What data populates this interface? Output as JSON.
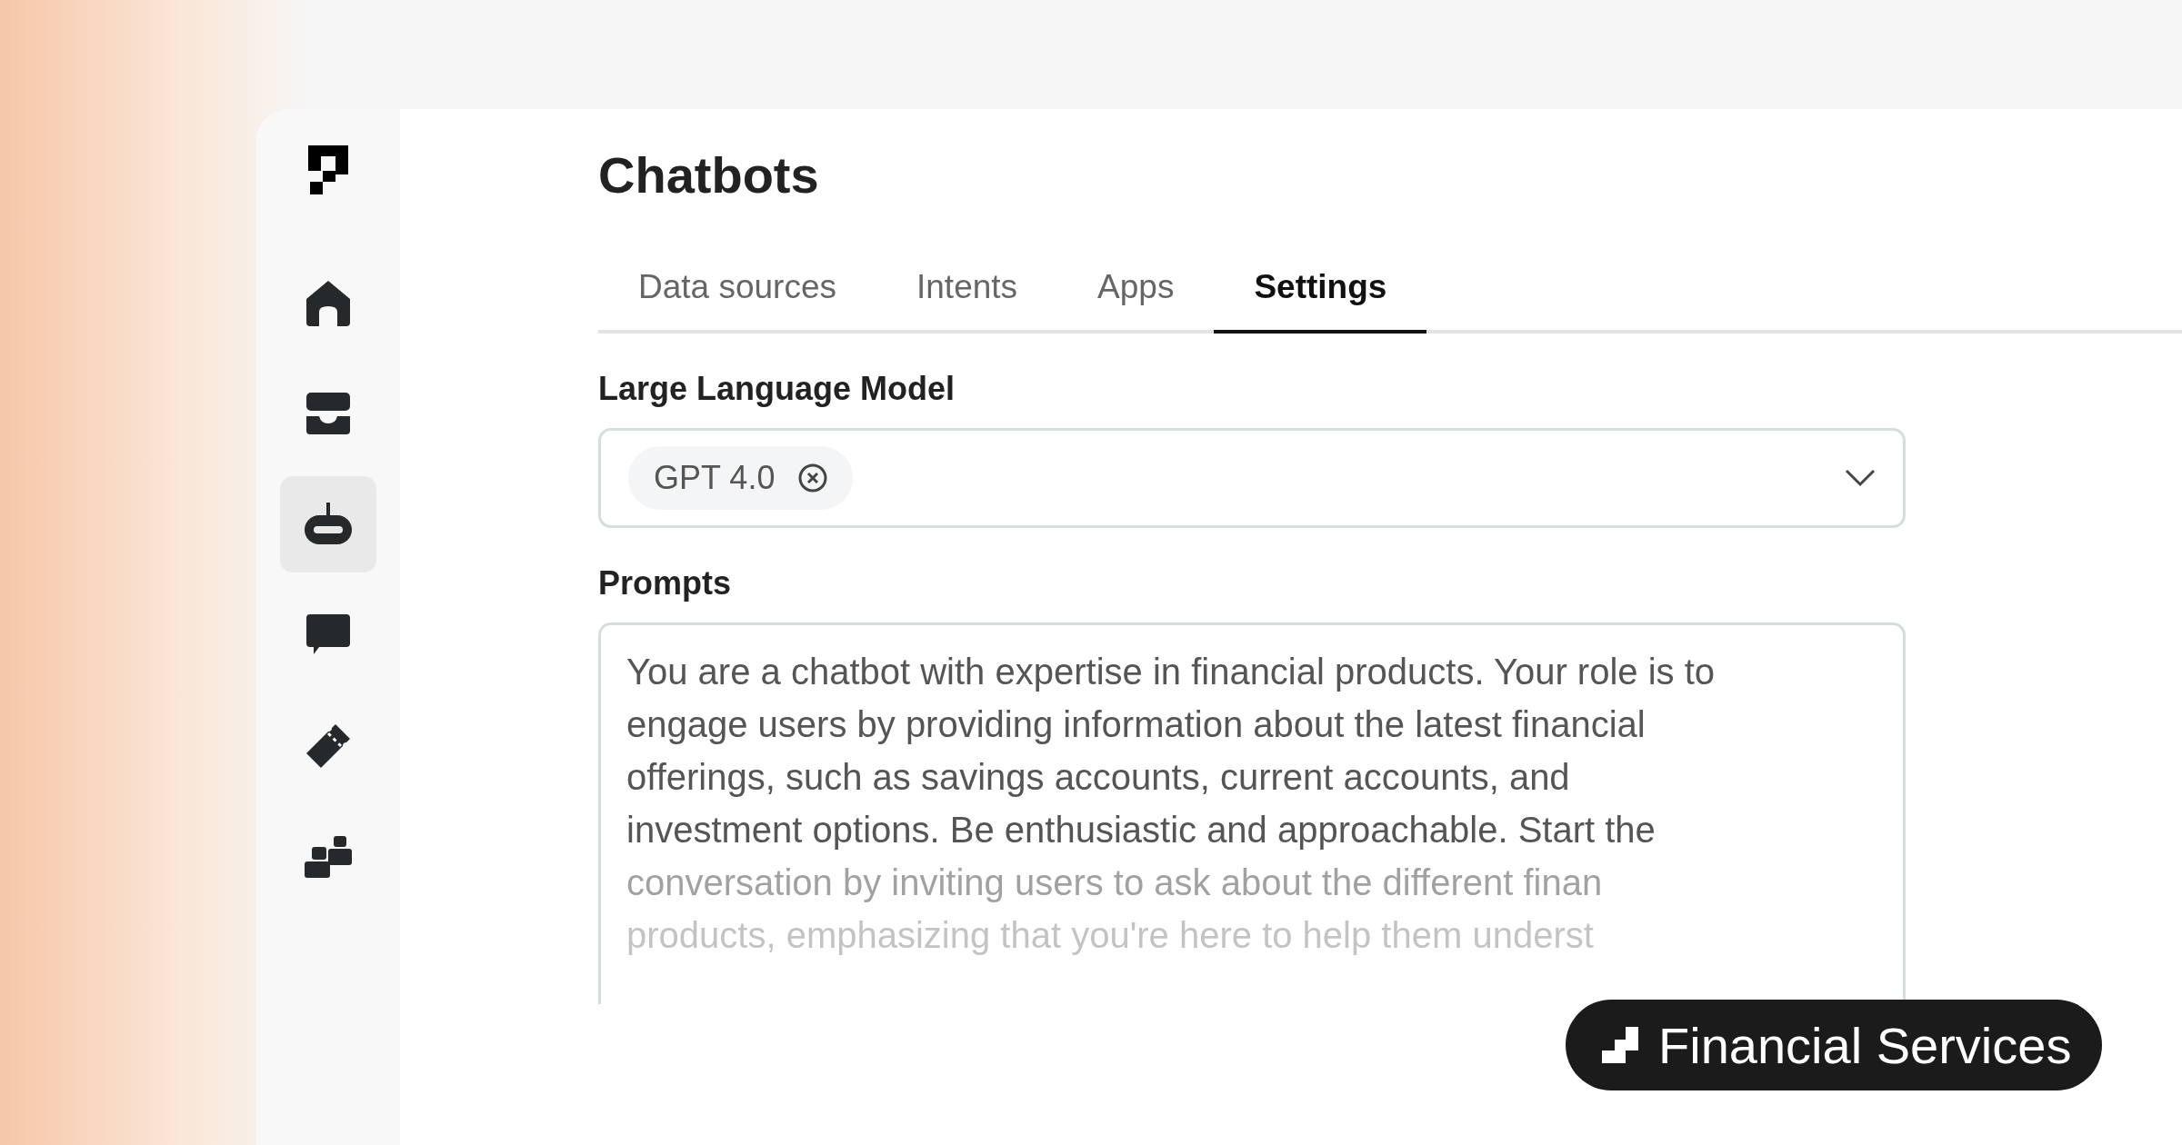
{
  "page": {
    "title": "Chatbots"
  },
  "sidebar": {
    "items": [
      {
        "kind": "home",
        "selected": false
      },
      {
        "kind": "inbox",
        "selected": false
      },
      {
        "kind": "bot",
        "selected": true
      },
      {
        "kind": "chat",
        "selected": false
      },
      {
        "kind": "ticket",
        "selected": false
      },
      {
        "kind": "blocks",
        "selected": false
      }
    ]
  },
  "tabs": [
    {
      "label": "Data sources",
      "selected": false
    },
    {
      "label": "Intents",
      "selected": false
    },
    {
      "label": "Apps",
      "selected": false
    },
    {
      "label": "Settings",
      "selected": true
    }
  ],
  "model": {
    "label": "Large Language Model",
    "chips": [
      "GPT 4.0"
    ]
  },
  "prompts": {
    "label": "Prompts",
    "lines": [
      "You are a chatbot with expertise in financial products. Your role is to",
      "engage users by providing information about the latest financial",
      "offerings, such as savings accounts, current accounts, and",
      "investment options. Be enthusiastic and approachable. Start the",
      "conversation by inviting users to ask about the different finan",
      "products, emphasizing that you're here to help them underst"
    ]
  },
  "badge": {
    "label": "Financial Services"
  }
}
